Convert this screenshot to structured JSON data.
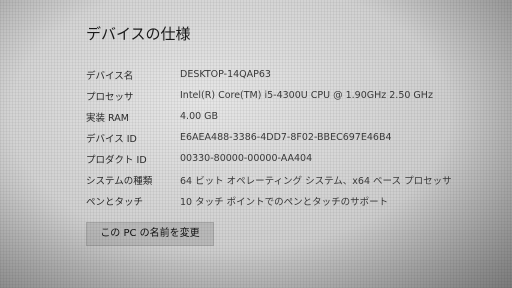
{
  "section": {
    "title": "デバイスの仕様"
  },
  "specs": [
    {
      "label": "デバイス名",
      "value": "DESKTOP-14QAP63"
    },
    {
      "label": "プロセッサ",
      "value": "Intel(R) Core(TM) i5-4300U CPU @ 1.90GHz   2.50 GHz"
    },
    {
      "label": "実装 RAM",
      "value": "4.00 GB"
    },
    {
      "label": "デバイス ID",
      "value": "E6AEA488-3386-4DD7-8F02-BBEC697E46B4"
    },
    {
      "label": "プロダクト ID",
      "value": "00330-80000-00000-AA404"
    },
    {
      "label": "システムの種類",
      "value": "64 ビット オペレーティング システム、x64 ベース プロセッサ"
    },
    {
      "label": "ペンとタッチ",
      "value": "10 タッチ ポイントでのペンとタッチのサポート"
    }
  ],
  "actions": {
    "rename_label": "この PC の名前を変更"
  },
  "colors": {
    "background": "#d4d4d4",
    "button": "#b9b9b9",
    "text": "#222222"
  }
}
